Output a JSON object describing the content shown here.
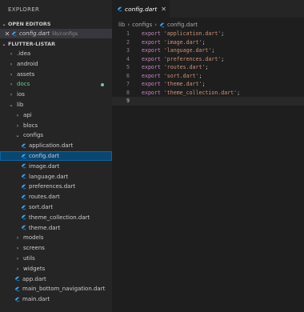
{
  "sidebar": {
    "title": "EXPLORER",
    "open_editors": {
      "header": "OPEN EDITORS",
      "items": [
        {
          "name": "config.dart",
          "description": "lib/configs"
        }
      ]
    },
    "project": {
      "header": "FLUTTER-LISTAR",
      "items": [
        {
          "label": ".idea",
          "type": "folder",
          "level": 0
        },
        {
          "label": "android",
          "type": "folder",
          "level": 0
        },
        {
          "label": "assets",
          "type": "folder",
          "level": 0
        },
        {
          "label": "docs",
          "type": "folder",
          "level": 0
        },
        {
          "label": "ios",
          "type": "folder",
          "level": 0
        },
        {
          "label": "lib",
          "type": "folder-open",
          "level": 0
        },
        {
          "label": "api",
          "type": "folder",
          "level": 1
        },
        {
          "label": "blocs",
          "type": "folder",
          "level": 1
        },
        {
          "label": "configs",
          "type": "folder-open",
          "level": 1
        },
        {
          "label": "application.dart",
          "type": "dart",
          "level": 2
        },
        {
          "label": "config.dart",
          "type": "dart",
          "level": 2
        },
        {
          "label": "image.dart",
          "type": "dart",
          "level": 2
        },
        {
          "label": "language.dart",
          "type": "dart",
          "level": 2
        },
        {
          "label": "preferences.dart",
          "type": "dart",
          "level": 2
        },
        {
          "label": "routes.dart",
          "type": "dart",
          "level": 2
        },
        {
          "label": "sort.dart",
          "type": "dart",
          "level": 2
        },
        {
          "label": "theme_collection.dart",
          "type": "dart",
          "level": 2
        },
        {
          "label": "theme.dart",
          "type": "dart",
          "level": 2
        },
        {
          "label": "models",
          "type": "folder",
          "level": 1
        },
        {
          "label": "screens",
          "type": "folder",
          "level": 1
        },
        {
          "label": "utils",
          "type": "folder",
          "level": 1
        },
        {
          "label": "widgets",
          "type": "folder",
          "level": 1
        },
        {
          "label": "app.dart",
          "type": "dart",
          "level": 1
        },
        {
          "label": "main_bottom_navigation.dart",
          "type": "dart",
          "level": 1
        },
        {
          "label": "main.dart",
          "type": "dart",
          "level": 1
        }
      ]
    }
  },
  "editor": {
    "tab": {
      "label": "config.dart"
    },
    "breadcrumb": {
      "part1": "lib",
      "part2": "configs",
      "part3": "config.dart"
    },
    "lines": [
      {
        "num": "1",
        "kw": "export",
        "str": "'application.dart'",
        "end": ";"
      },
      {
        "num": "2",
        "kw": "export",
        "str": "'image.dart'",
        "end": ";"
      },
      {
        "num": "3",
        "kw": "export",
        "str": "'language.dart'",
        "end": ";"
      },
      {
        "num": "4",
        "kw": "export",
        "str": "'preferences.dart'",
        "end": ";"
      },
      {
        "num": "5",
        "kw": "export",
        "str": "'routes.dart'",
        "end": ";"
      },
      {
        "num": "6",
        "kw": "export",
        "str": "'sort.dart'",
        "end": ";"
      },
      {
        "num": "7",
        "kw": "export",
        "str": "'theme.dart'",
        "end": ";"
      },
      {
        "num": "8",
        "kw": "export",
        "str": "'theme_collection.dart'",
        "end": ";"
      },
      {
        "num": "9",
        "kw": "",
        "str": "",
        "end": ""
      }
    ]
  },
  "colors": {
    "dart_icon": "#41a5e5",
    "docs_git": "#73c991",
    "selection": "#094771"
  }
}
